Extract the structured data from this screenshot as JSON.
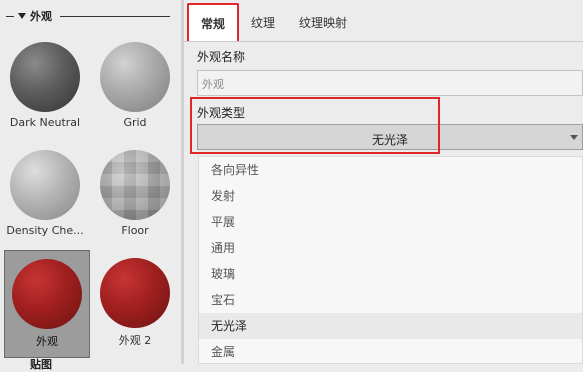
{
  "left": {
    "section_title": "外观",
    "swatches": [
      {
        "label": "Dark Neutral"
      },
      {
        "label": "Grid"
      },
      {
        "label": "Density Che..."
      },
      {
        "label": "Floor"
      },
      {
        "label": "外观"
      },
      {
        "label": "外观 2"
      }
    ],
    "bottom_label": "贴图"
  },
  "tabs": [
    {
      "label": "常规"
    },
    {
      "label": "纹理"
    },
    {
      "label": "纹理映射"
    }
  ],
  "appearance_name": {
    "label": "外观名称",
    "placeholder": "外观"
  },
  "appearance_type": {
    "label": "外观类型",
    "value": "无光泽"
  },
  "type_options": [
    "各向异性",
    "发射",
    "平展",
    "通用",
    "玻璃",
    "宝石",
    "无光泽",
    "金属"
  ],
  "colors": {
    "highlight_border": "#e0262a",
    "selected_swatch_bg": "#9c9c9c",
    "material_red": "#9e1f1f"
  }
}
